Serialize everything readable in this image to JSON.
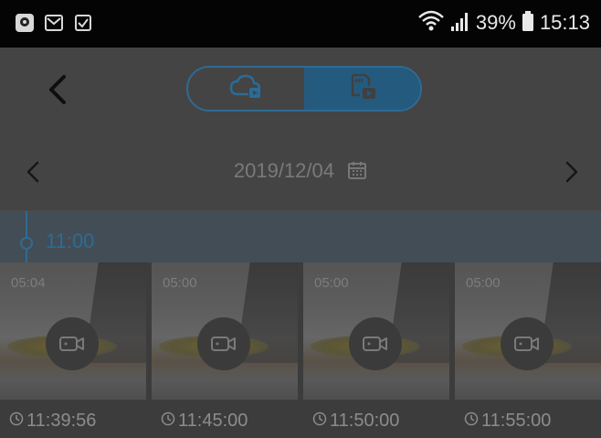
{
  "statusbar": {
    "left_icons": [
      "shield-app-icon",
      "mail-icon",
      "checkbox-icon"
    ],
    "battery_percent": "39%",
    "time": "15:13"
  },
  "header": {
    "segments": [
      {
        "name": "cloud-playback",
        "icon": "cloud-play-icon",
        "active": false
      },
      {
        "name": "sd-card-playback",
        "icon": "sd-card-play-icon",
        "active": true
      }
    ]
  },
  "date_row": {
    "date": "2019/12/04"
  },
  "timeline": {
    "hour": "11:00"
  },
  "clips": [
    {
      "duration": "05:04",
      "time": "11:39:56"
    },
    {
      "duration": "05:00",
      "time": "11:45:00"
    },
    {
      "duration": "05:00",
      "time": "11:50:00"
    },
    {
      "duration": "05:00",
      "time": "11:55:00"
    }
  ],
  "colors": {
    "accent": "#2a6c97",
    "overlay_bg": "#444444"
  }
}
